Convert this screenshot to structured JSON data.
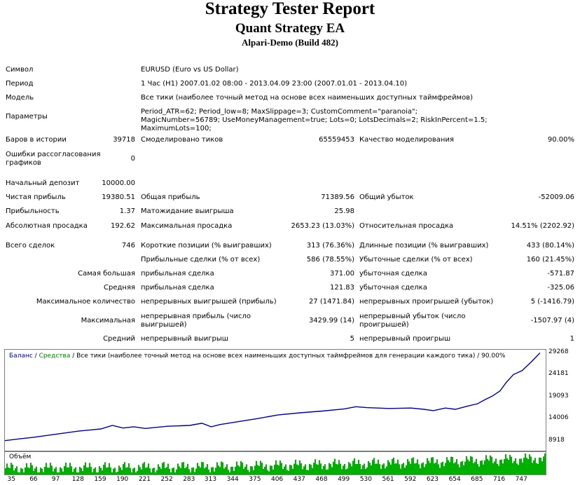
{
  "report": {
    "title": "Strategy Tester Report",
    "subtitle": "Quant Strategy EA",
    "build": "Alpari-Demo (Build 482)"
  },
  "rows": {
    "symbol": {
      "label": "Символ",
      "value": "EURUSD (Euro vs US Dollar)"
    },
    "period": {
      "label": "Период",
      "value": "1 Час (H1) 2007.01.02 08:00 - 2013.04.09 23:00 (2007.01.01 - 2013.04.10)"
    },
    "model": {
      "label": "Модель",
      "value": "Все тики (наиболее точный метод на основе всех наименьших доступных таймфреймов)"
    },
    "params": {
      "label": "Параметры",
      "value": "Period_ATR=62; Period_low=8; MaxSlippage=3; CustomComment=\"paranoia\"; MagicNumber=56789; UseMoneyManagement=true; Lots=0; LotsDecimals=2; RiskInPercent=1.5; MaximumLots=100;"
    },
    "bars": {
      "label": "Баров в истории",
      "value": "39718"
    },
    "ticks": {
      "label": "Смоделировано тиков",
      "value": "65559453"
    },
    "quality": {
      "label": "Качество моделирования",
      "value": "90.00%"
    },
    "mismatch": {
      "label": "Ошибки рассогласования графиков",
      "value": "0"
    },
    "deposit": {
      "label": "Начальный депозит",
      "value": "10000.00"
    },
    "net_profit": {
      "label": "Чистая прибыль",
      "value": "19380.51"
    },
    "gross_profit": {
      "label": "Общая прибыль",
      "value": "71389.56"
    },
    "gross_loss": {
      "label": "Общий убыток",
      "value": "-52009.06"
    },
    "profit_factor": {
      "label": "Прибыльность",
      "value": "1.37"
    },
    "expected_payoff": {
      "label": "Матожидание выигрыша",
      "value": "25.98"
    },
    "abs_dd": {
      "label": "Абсолютная просадка",
      "value": "192.62"
    },
    "max_dd": {
      "label": "Максимальная просадка",
      "value": "2653.23 (13.03%)"
    },
    "rel_dd": {
      "label": "Относительная просадка",
      "value": "14.51% (2202.92)"
    },
    "total_trades": {
      "label": "Всего сделок",
      "value": "746"
    },
    "short_pos": {
      "label": "Короткие позиции (% выигравших)",
      "value": "313 (76.36%)"
    },
    "long_pos": {
      "label": "Длинные позиции (% выигравших)",
      "value": "433 (80.14%)"
    },
    "profit_trades": {
      "label": "Прибыльные сделки (% от всех)",
      "value": "586 (78.55%)"
    },
    "loss_trades": {
      "label": "Убыточные сделки (% от всех)",
      "value": "160 (21.45%)"
    },
    "largest": {
      "label": "Самая большая",
      "p_label": "прибыльная сделка",
      "p_value": "371.00",
      "l_label": "убыточная сделка",
      "l_value": "-571.87"
    },
    "average": {
      "label": "Средняя",
      "p_label": "прибыльная сделка",
      "p_value": "121.83",
      "l_label": "убыточная сделка",
      "l_value": "-325.06"
    },
    "max_count": {
      "label": "Максимальное количество",
      "p_label": "непрерывных выигрышей (прибыль)",
      "p_value": "27 (1471.84)",
      "l_label": "непрерывных проигрышей (убыток)",
      "l_value": "5 (-1416.79)"
    },
    "maximal": {
      "label": "Максимальная",
      "p_label": "непрерывная прибыль (число выигрышей)",
      "p_value": "3429.99 (14)",
      "l_label": "непрерывный убыток (число проигрышей)",
      "l_value": "-1507.97 (4)"
    },
    "avg_cons": {
      "label": "Средний",
      "p_label": "непрерывный выигрыш",
      "p_value": "5",
      "l_label": "непрерывный проигрыш",
      "l_value": "1"
    }
  },
  "colors": {
    "balance": "#00008b",
    "equity": "#008000",
    "volume": "#00b000",
    "axis": "#7f7f7f"
  },
  "chart_data": {
    "type": "line",
    "legend": {
      "balance": "Баланс",
      "separator": " / ",
      "equity": "Средства",
      "text": " / Все тики (наиболее точный метод на основе всех наименьших доступных таймфреймов для генерации каждого тика) / 90.00%"
    },
    "volume_label": "Объём",
    "xlim": [
      25,
      780
    ],
    "ylim": [
      6800,
      30000
    ],
    "y_ticks": [
      "29268",
      "24181",
      "19093",
      "14006",
      "8918"
    ],
    "x_ticks": [
      "35",
      "66",
      "97",
      "128",
      "159",
      "190",
      "221",
      "252",
      "283",
      "313",
      "344",
      "375",
      "406",
      "437",
      "468",
      "499",
      "530",
      "561",
      "592",
      "623",
      "654",
      "685",
      "716",
      "747"
    ],
    "series": [
      {
        "name": "Баланс",
        "x": [
          25,
          45,
          66,
          97,
          128,
          159,
          175,
          190,
          205,
          221,
          252,
          283,
          300,
          313,
          325,
          344,
          375,
          406,
          437,
          468,
          499,
          515,
          530,
          561,
          592,
          610,
          623,
          640,
          654,
          670,
          685,
          695,
          705,
          716,
          725,
          735,
          747,
          760,
          772
        ],
        "y": [
          9100,
          9500,
          9900,
          10600,
          11300,
          11800,
          12600,
          12000,
          12300,
          11900,
          12400,
          12600,
          13100,
          12300,
          12800,
          13300,
          14100,
          15000,
          15500,
          15900,
          16400,
          16900,
          16700,
          16500,
          16600,
          16300,
          16000,
          16600,
          16300,
          17000,
          17600,
          18500,
          19300,
          20500,
          22500,
          24300,
          25200,
          27200,
          29268
        ]
      }
    ]
  }
}
